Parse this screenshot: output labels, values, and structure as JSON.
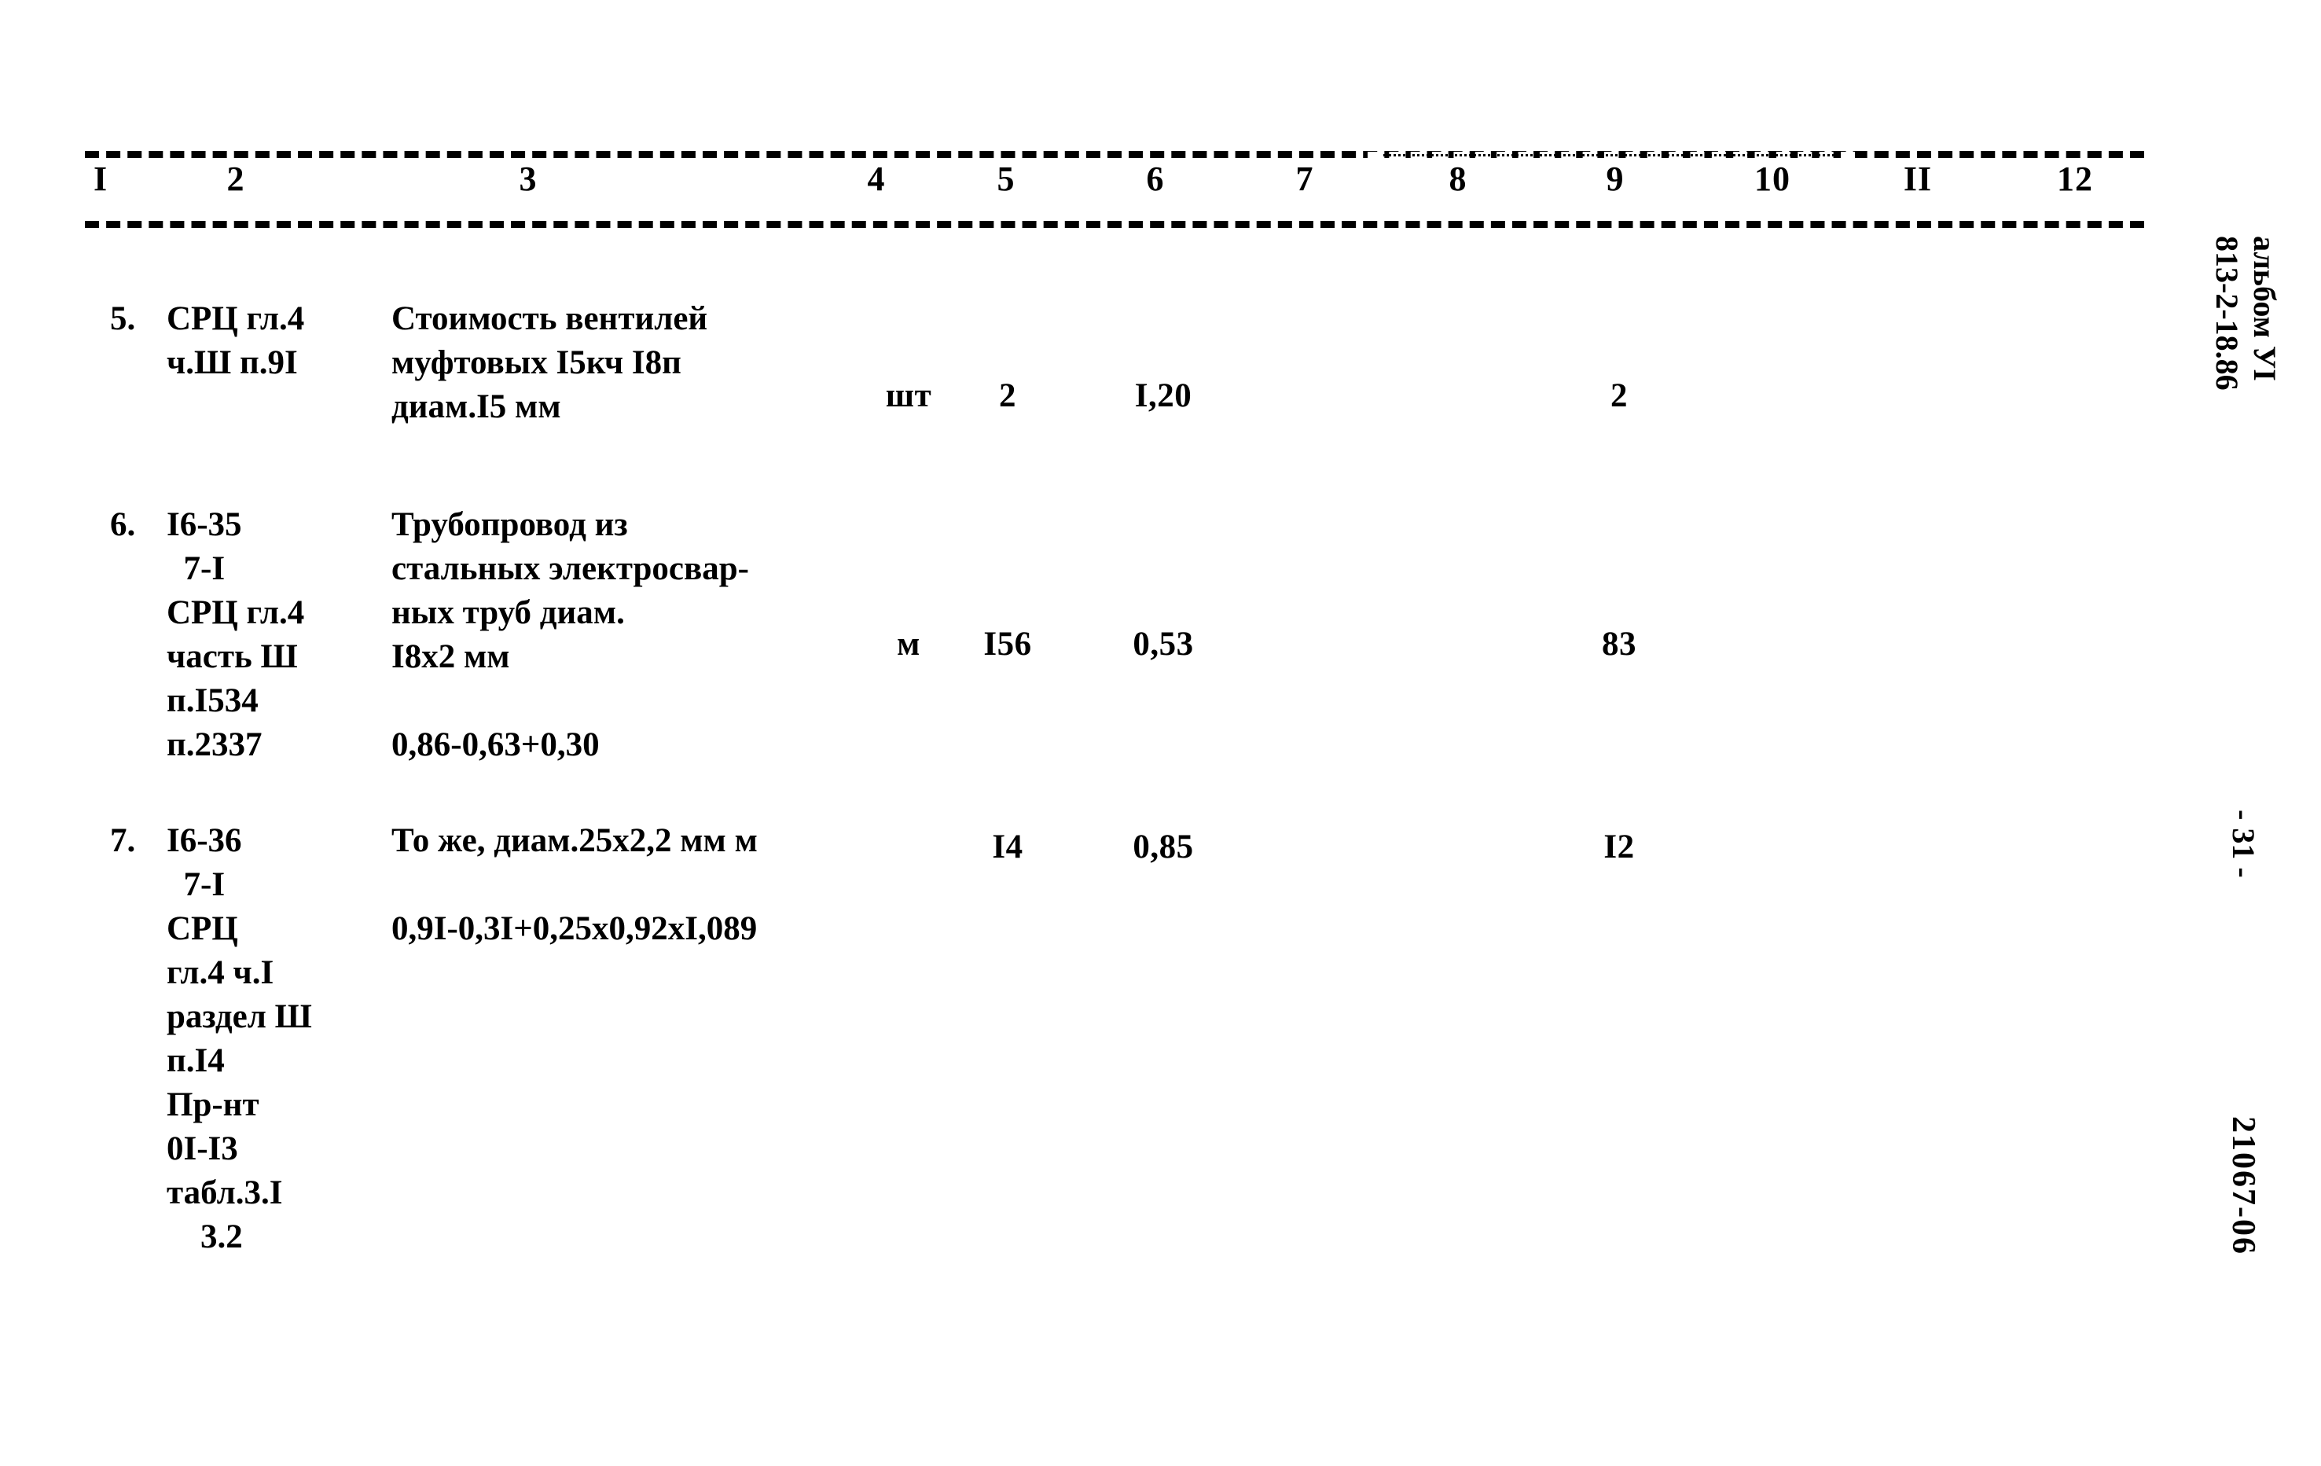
{
  "document": {
    "type": "scanned-estimate-table",
    "background_color": "#ffffff",
    "ink_color": "#000000"
  },
  "table": {
    "column_headers": [
      "I",
      "2",
      "3",
      "4",
      "5",
      "6",
      "7",
      "8",
      "9",
      "10",
      "II",
      "12"
    ],
    "rows": [
      {
        "index": "5.",
        "code_lines": [
          "СРЦ гл.4",
          "ч.Ш п.9I"
        ],
        "description_lines": [
          "Стоимоcть вентилей",
          "муфтовых I5кч I8п",
          "диам.I5 мм"
        ],
        "unit": "шт",
        "quantity": "2",
        "price": "I,20",
        "col7": "",
        "col8": "",
        "col9": "2",
        "col10": "",
        "col11": "",
        "col12": ""
      },
      {
        "index": "6.",
        "code_lines": [
          "I6-35",
          "  7-I",
          "СРЦ гл.4",
          "часть Ш",
          "п.I534",
          "п.2337"
        ],
        "description_lines": [
          "Трубопровод из",
          "стальных электросвар-",
          "ных труб диам.",
          "I8х2 мм",
          "",
          "0,86-0,63+0,30"
        ],
        "unit": "м",
        "quantity": "I56",
        "price": "0,53",
        "col7": "",
        "col8": "",
        "col9": "83",
        "col10": "",
        "col11": "",
        "col12": ""
      },
      {
        "index": "7.",
        "code_lines": [
          "I6-36",
          "  7-I",
          "СРЦ",
          "гл.4 ч.I",
          "раздел Ш",
          "п.I4",
          "Пр-нт",
          "0I-I3",
          "табл.3.I",
          "    3.2"
        ],
        "description_lines": [
          "То же, диам.25х2,2 мм м",
          "",
          "0,9I-0,3I+0,25х0,92хI,089"
        ],
        "unit": "",
        "quantity": "I4",
        "price": "0,85",
        "col7": "",
        "col8": "",
        "col9": "I2",
        "col10": "",
        "col11": "",
        "col12": ""
      }
    ]
  },
  "margin_notes": {
    "album": "альбом УI\n813-2-18.86",
    "page_number": "- 31 -",
    "doc_code": "21067-06"
  }
}
